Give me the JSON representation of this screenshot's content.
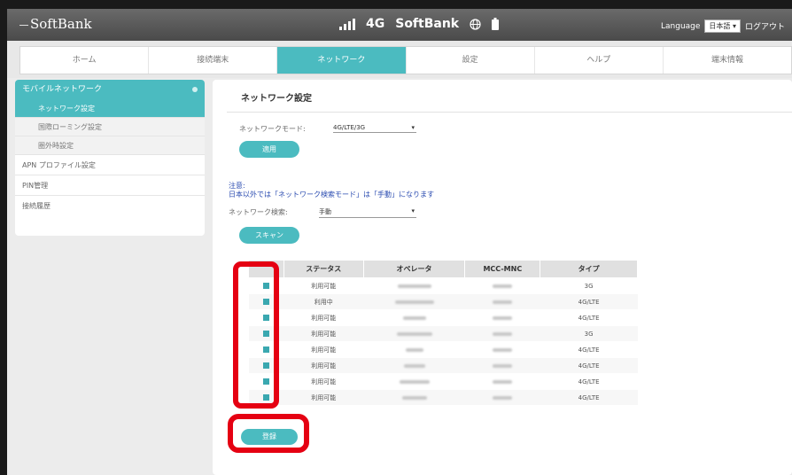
{
  "app": {
    "brand": "SoftBank"
  },
  "status": {
    "network_type": "4G",
    "carrier": "SoftBank",
    "globe_icon": "globe-icon",
    "battery_icon": "battery-icon"
  },
  "language": {
    "label": "Language",
    "value": "日本語",
    "logout": "ログアウト"
  },
  "tabs": [
    {
      "label": "ホーム"
    },
    {
      "label": "接続端末"
    },
    {
      "label": "ネットワーク",
      "active": true
    },
    {
      "label": "設定"
    },
    {
      "label": "ヘルプ"
    },
    {
      "label": "端末情報"
    }
  ],
  "sidebar": {
    "group": "モバイルネットワーク",
    "subitems": [
      "ネットワーク設定",
      "国際ローミング設定",
      "圏外時設定"
    ],
    "items": [
      "APN プロファイル設定",
      "PIN管理",
      "接続履歴"
    ]
  },
  "page": {
    "title": "ネットワーク設定",
    "mode_label": "ネットワークモード:",
    "mode_value": "4G/LTE/3G",
    "apply_button": "適用",
    "note_title": "注意:",
    "note_text": "日本以外では「ネットワーク検索モード」は「手動」になります",
    "search_label": "ネットワーク検索:",
    "search_value": "手動",
    "scan_button": "スキャン",
    "register_button": "登録"
  },
  "table": {
    "headers": [
      "",
      "ステータス",
      "オペレータ",
      "MCC-MNC",
      "タイプ"
    ],
    "rows": [
      {
        "status": "利用可能",
        "type": "3G"
      },
      {
        "status": "利用中",
        "type": "4G/LTE"
      },
      {
        "status": "利用可能",
        "type": "4G/LTE"
      },
      {
        "status": "利用可能",
        "type": "3G"
      },
      {
        "status": "利用可能",
        "type": "4G/LTE"
      },
      {
        "status": "利用可能",
        "type": "4G/LTE"
      },
      {
        "status": "利用可能",
        "type": "4G/LTE"
      },
      {
        "status": "利用可能",
        "type": "4G/LTE"
      }
    ]
  },
  "colors": {
    "accent": "#4bbbc0",
    "highlight": "#e50012",
    "note": "#2a4bb0"
  }
}
